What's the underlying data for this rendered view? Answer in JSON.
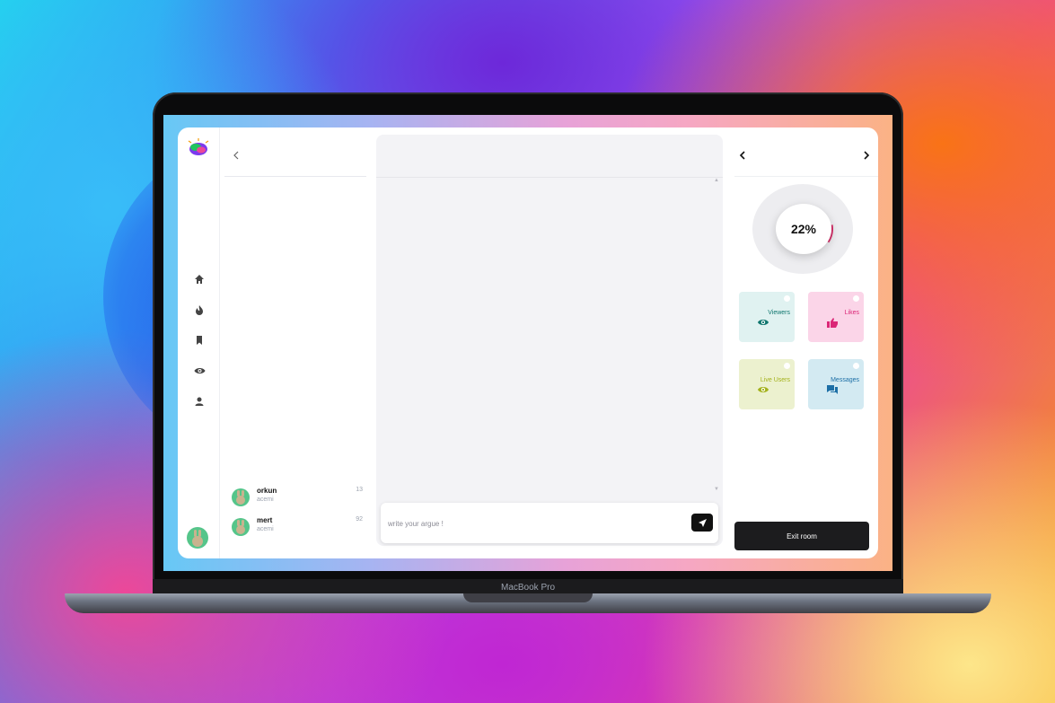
{
  "device": {
    "label": "MacBook Pro"
  },
  "sidebar": {
    "logo_icon": "chat-bubble-logo",
    "items": [
      {
        "icon": "home-icon"
      },
      {
        "icon": "fire-icon"
      },
      {
        "icon": "bookmark-icon"
      },
      {
        "icon": "eye-icon"
      },
      {
        "icon": "person-icon"
      }
    ],
    "avatar_icon": "bunny-avatar"
  },
  "user_list": {
    "users": [
      {
        "name": "orkun",
        "subtitle": "acemi",
        "count": "13"
      },
      {
        "name": "mert",
        "subtitle": "acemi",
        "count": "92"
      }
    ]
  },
  "chat": {
    "input_placeholder": "write your argue !",
    "input_value": ""
  },
  "stats": {
    "progress_label": "22%",
    "progress_value": 0.22,
    "cards": [
      {
        "label": "Viewers",
        "icon": "eye-icon",
        "bg": "#e0f2f1",
        "accent": "#0f766e"
      },
      {
        "label": "Likes",
        "icon": "thumbs-up-icon",
        "bg": "#fbd5e8",
        "accent": "#db2777"
      },
      {
        "label": "Live Users",
        "icon": "eye-icon",
        "bg": "#ecf1cf",
        "accent": "#a3b11a"
      },
      {
        "label": "Messages",
        "icon": "chat-bubbles-icon",
        "bg": "#d3eaf2",
        "accent": "#1d6fa6"
      }
    ],
    "exit_label": "Exit room"
  },
  "colors": {
    "accent_pink": "#d6336c",
    "dark": "#1c1c1e"
  }
}
